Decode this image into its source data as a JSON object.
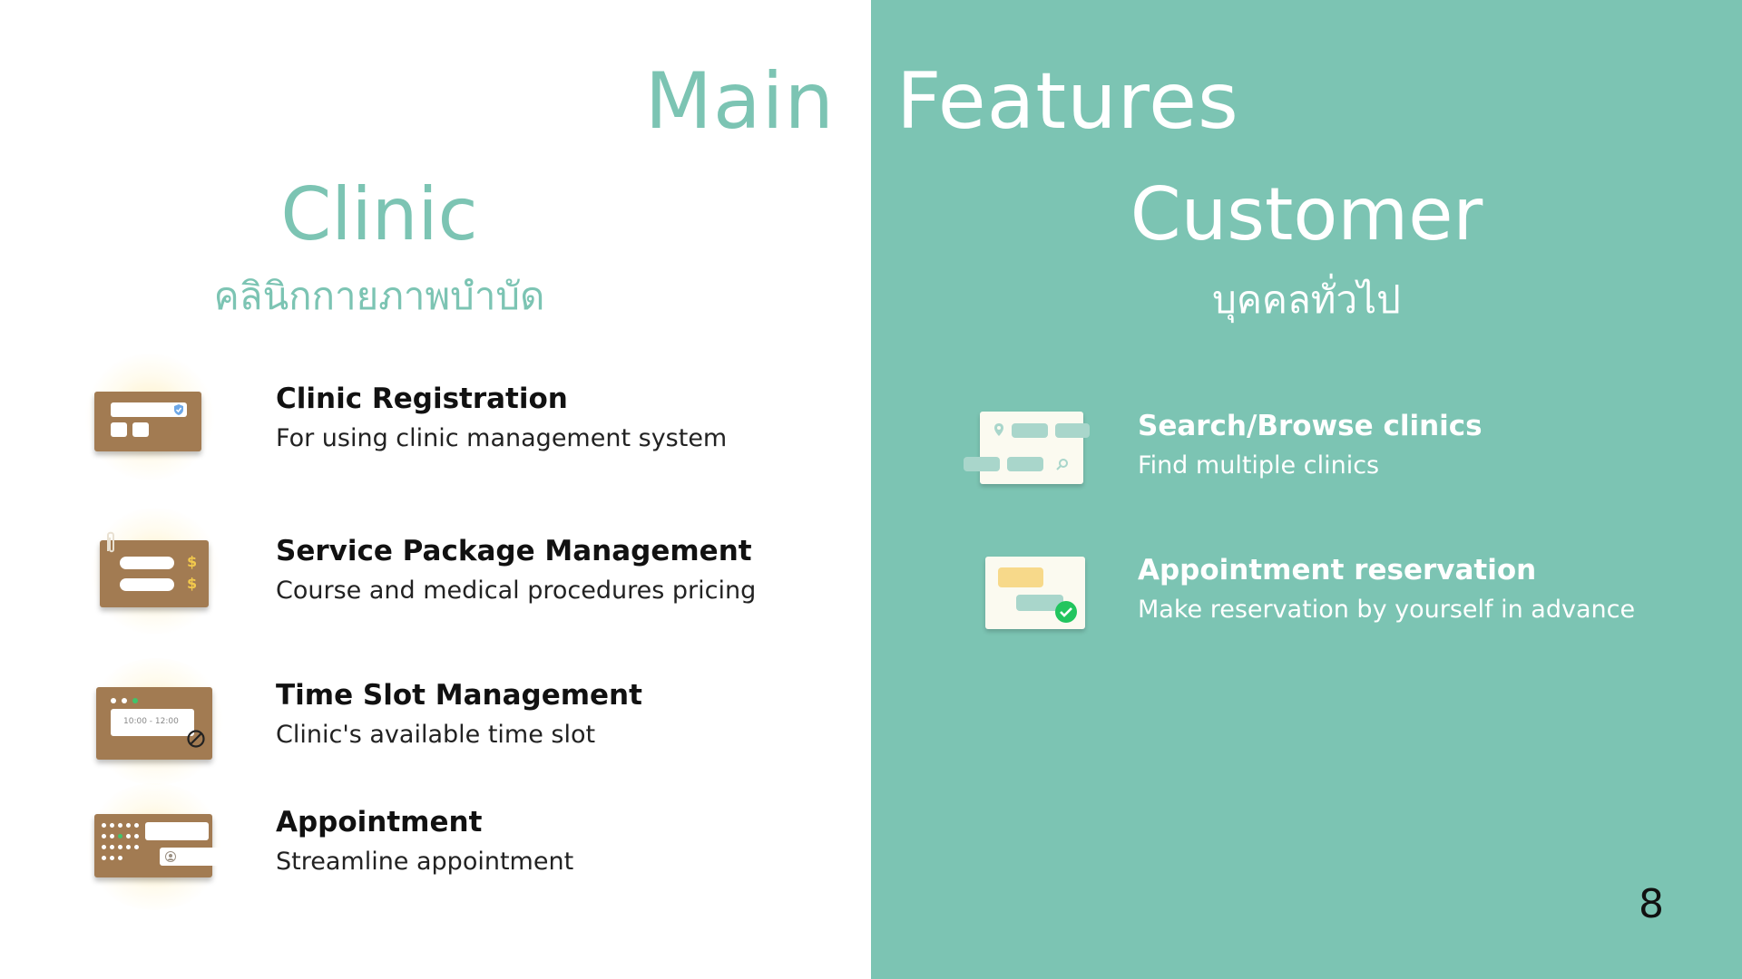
{
  "slide": {
    "title_left": "Main",
    "title_right": "Features",
    "page_number": "8"
  },
  "clinic": {
    "title": "Clinic",
    "subtitle": "คลินิกกายภาพบำบัด",
    "features": [
      {
        "title": "Clinic Registration",
        "description": "For using clinic management system",
        "icon": "registration-card-icon"
      },
      {
        "title": "Service Package Management",
        "description": "Course and medical procedures pricing",
        "icon": "price-list-icon"
      },
      {
        "title": "Time Slot Management",
        "description": "Clinic's available time slot",
        "icon": "time-slot-icon",
        "icon_text": "10:00 - 12:00"
      },
      {
        "title": "Appointment",
        "description": "Streamline appointment",
        "icon": "appointment-calendar-icon"
      }
    ]
  },
  "customer": {
    "title": "Customer",
    "subtitle": "บุคคลทั่วไป",
    "features": [
      {
        "title": "Search/Browse clinics",
        "description": "Find multiple clinics",
        "icon": "search-map-icon"
      },
      {
        "title": "Appointment reservation",
        "description": "Make reservation by yourself in advance",
        "icon": "reservation-check-icon"
      }
    ]
  },
  "colors": {
    "accent": "#7cc4b3",
    "card_brown": "#a27b52",
    "check_green": "#22c55e",
    "dollar_yellow": "#f2c94c"
  }
}
